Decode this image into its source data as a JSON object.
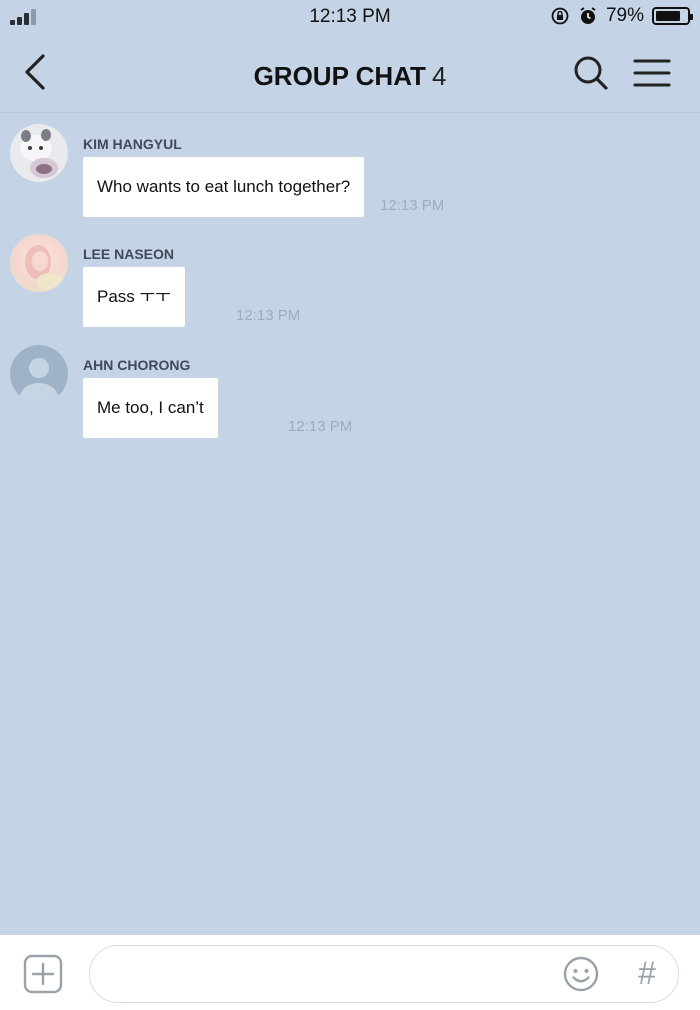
{
  "status_bar": {
    "time": "12:13 PM",
    "battery": "79%",
    "battery_level": 0.79
  },
  "header": {
    "title": "GROUP CHAT",
    "member_count": "4"
  },
  "messages": [
    {
      "sender": "KIM HANGYUL",
      "text": "Who wants to eat lunch together?",
      "time": "12:13 PM"
    },
    {
      "sender": "LEE NASEON",
      "text": "Pass ㅜㅜ",
      "time": "12:13 PM"
    },
    {
      "sender": "AHN CHORONG",
      "text": "Me too, I can’t",
      "time": "12:13 PM"
    }
  ],
  "composer": {
    "placeholder": "",
    "hashtag_symbol": "#"
  },
  "colors": {
    "chat_background": "#c4d4e6",
    "bubble": "#ffffff",
    "sender_name": "#404a59",
    "timestamp": "#9eadbd"
  },
  "icons": {
    "back": "chevron-left-icon",
    "search": "search-icon",
    "menu": "hamburger-menu-icon",
    "add": "plus-square-icon",
    "emoji": "smiley-icon"
  }
}
